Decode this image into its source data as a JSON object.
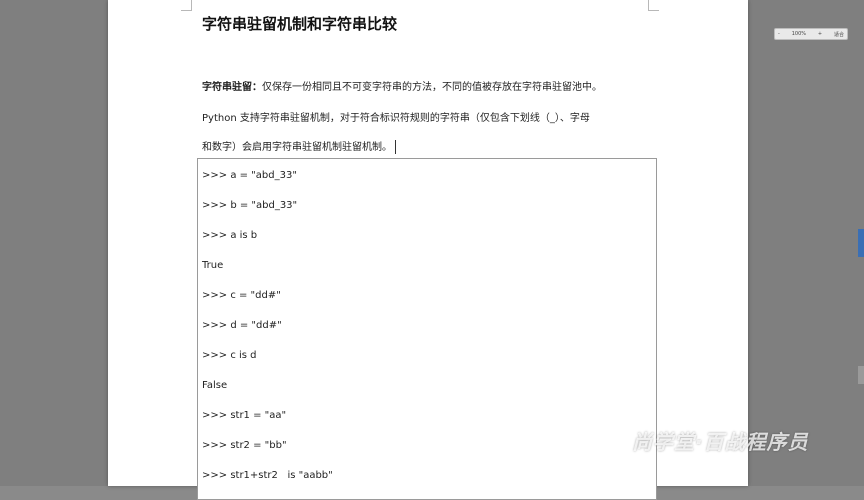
{
  "document": {
    "title": "字符串驻留机制和字符串比较",
    "para1_bold": "字符串驻留：",
    "para1_rest": "仅保存一份相同且不可变字符串的方法，不同的值被存放在字符串驻留池中。",
    "para2": "Python 支持字符串驻留机制，对于符合标识符规则的字符串（仅包含下划线（_）、字母",
    "para3": "和数字）会启用字符串驻留机制驻留机制。"
  },
  "code_lines": [
    ">>> a = \"abd_33\"",
    ">>> b = \"abd_33\"",
    ">>> a is b",
    "True",
    ">>> c = \"dd#\"",
    ">>> d = \"dd#\"",
    ">>> c is d",
    "False",
    ">>> str1 = \"aa\"",
    ">>> str2 = \"bb\"",
    ">>> str1+str2   is \"aabb\""
  ],
  "zoom": {
    "minus": "-",
    "value": "100%",
    "plus": "+",
    "fit": "适合"
  },
  "watermark": "尚学堂·百战程序员"
}
